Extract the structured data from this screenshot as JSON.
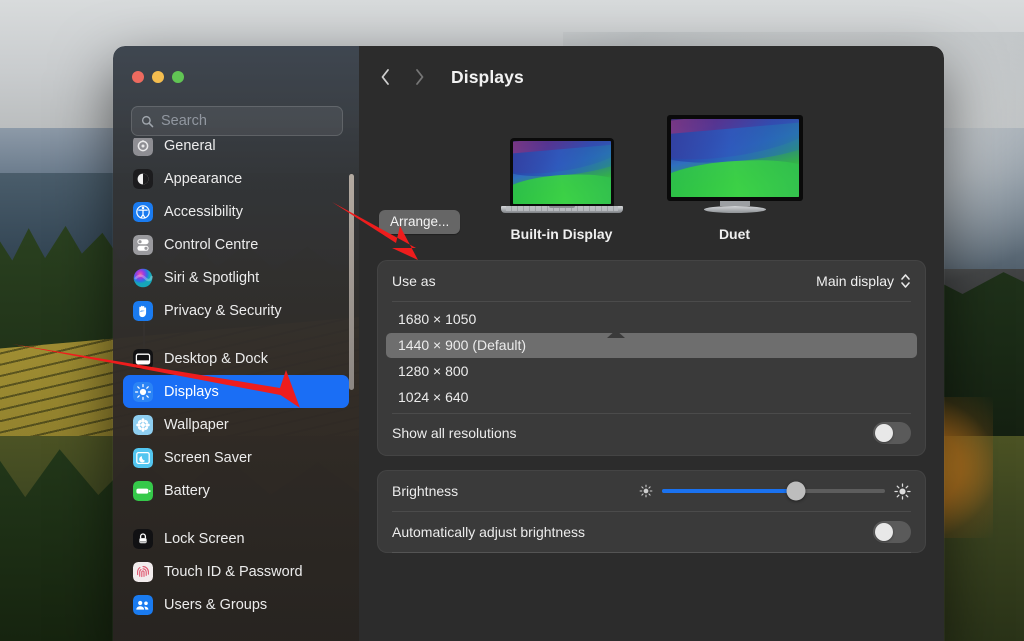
{
  "window": {
    "traffic_lights": [
      {
        "name": "close",
        "color": "#ed6a5f"
      },
      {
        "name": "minimize",
        "color": "#f4bd4f"
      },
      {
        "name": "zoom",
        "color": "#61c554"
      }
    ]
  },
  "search": {
    "placeholder": "Search"
  },
  "sidebar": {
    "groups": [
      {
        "items": [
          {
            "label": "General",
            "icon": "gear-icon",
            "selected": false
          },
          {
            "label": "Appearance",
            "icon": "appearance-icon",
            "selected": false
          },
          {
            "label": "Accessibility",
            "icon": "accessibility-icon",
            "selected": false
          },
          {
            "label": "Control Centre",
            "icon": "control-centre-icon",
            "selected": false
          },
          {
            "label": "Siri & Spotlight",
            "icon": "siri-icon",
            "selected": false
          },
          {
            "label": "Privacy & Security",
            "icon": "privacy-icon",
            "selected": false
          }
        ]
      },
      {
        "items": [
          {
            "label": "Desktop & Dock",
            "icon": "desktop-dock-icon",
            "selected": false
          },
          {
            "label": "Displays",
            "icon": "displays-icon",
            "selected": true
          },
          {
            "label": "Wallpaper",
            "icon": "wallpaper-icon",
            "selected": false
          },
          {
            "label": "Screen Saver",
            "icon": "screen-saver-icon",
            "selected": false
          },
          {
            "label": "Battery",
            "icon": "battery-icon",
            "selected": false
          }
        ]
      },
      {
        "items": [
          {
            "label": "Lock Screen",
            "icon": "lock-screen-icon",
            "selected": false
          },
          {
            "label": "Touch ID & Password",
            "icon": "touch-id-icon",
            "selected": false
          },
          {
            "label": "Users & Groups",
            "icon": "users-groups-icon",
            "selected": false
          }
        ]
      }
    ]
  },
  "toolbar": {
    "back_icon": "chevron-left-icon",
    "forward_icon": "chevron-right-icon",
    "title": "Displays"
  },
  "main": {
    "arrange_button": "Arrange...",
    "displays": [
      {
        "name": "Built-in Display",
        "type": "laptop"
      },
      {
        "name": "Duet",
        "type": "monitor"
      }
    ],
    "use_as": {
      "label": "Use as",
      "value": "Main display"
    },
    "resolutions": [
      {
        "label": "1680 × 1050",
        "selected": false
      },
      {
        "label": "1440 × 900 (Default)",
        "selected": true
      },
      {
        "label": "1280 × 800",
        "selected": false
      },
      {
        "label": "1024 × 640",
        "selected": false
      }
    ],
    "show_all_resolutions": {
      "label": "Show all resolutions",
      "enabled": false
    },
    "brightness": {
      "label": "Brightness",
      "value_percent": 60
    },
    "auto_brightness": {
      "label": "Automatically adjust brightness",
      "enabled": false
    }
  },
  "annotations": {
    "accent_color": "#ee1d1d",
    "arrows": [
      {
        "name": "arrow-to-arrange",
        "points_to": "Arrange..."
      },
      {
        "name": "arrow-to-displays",
        "points_to": "Displays"
      }
    ]
  }
}
